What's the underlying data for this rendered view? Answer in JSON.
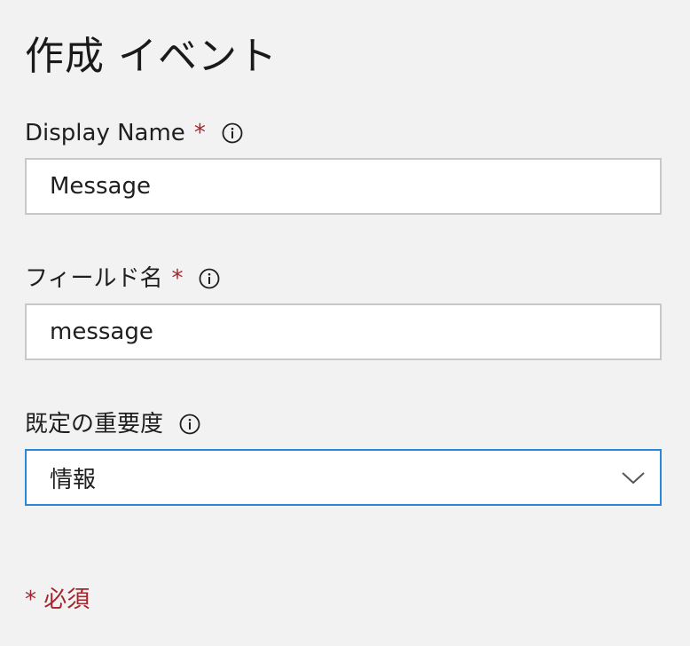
{
  "page": {
    "title": "作成 イベント"
  },
  "fields": {
    "display_name": {
      "label": "Display Name",
      "required_mark": "*",
      "value": "Message",
      "info_icon": "info-icon"
    },
    "field_name": {
      "label": "フィールド名",
      "required_mark": "*",
      "value": "message",
      "info_icon": "info-icon"
    },
    "default_severity": {
      "label": "既定の重要度",
      "selected": "情報",
      "info_icon": "info-icon",
      "dropdown_icon": "chevron-down-icon"
    }
  },
  "footer": {
    "required_note": "* 必須"
  },
  "colors": {
    "background": "#f2f2f2",
    "required": "#a4262c",
    "focus_border": "#2b88d8",
    "input_border": "#c8c8c8"
  }
}
